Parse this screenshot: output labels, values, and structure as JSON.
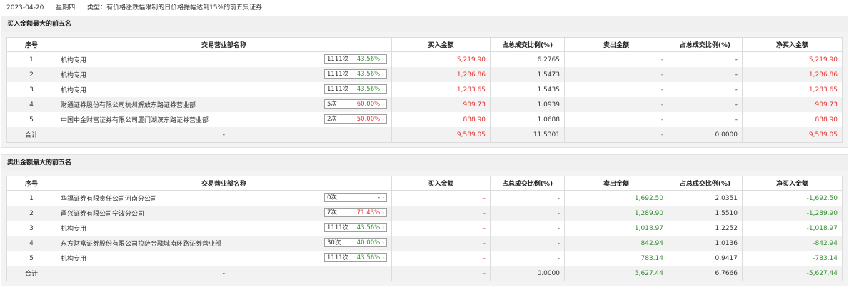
{
  "header": {
    "date": "2023-04-20",
    "weekday": "星期四",
    "type_text": "类型：有价格涨跌幅限制的日价格振幅达到15%的前五只证券"
  },
  "columns": [
    "序号",
    "交易营业部名称",
    "买入金额",
    "占总成交比例(%)",
    "卖出金额",
    "占总成交比例(%)",
    "净买入金额"
  ],
  "buy_section": {
    "title": "买入金额最大的前五名",
    "rows": [
      {
        "no": "1",
        "name": "机构专用",
        "count": "1111次",
        "pct": "43.56%",
        "pct_color": "green",
        "buy": "5,219.90",
        "buy_ratio": "6.2765",
        "sell": "-",
        "sell_ratio": "-",
        "net": "5,219.90"
      },
      {
        "no": "2",
        "name": "机构专用",
        "count": "1111次",
        "pct": "43.56%",
        "pct_color": "green",
        "buy": "1,286.86",
        "buy_ratio": "1.5473",
        "sell": "-",
        "sell_ratio": "-",
        "net": "1,286.86"
      },
      {
        "no": "3",
        "name": "机构专用",
        "count": "1111次",
        "pct": "43.56%",
        "pct_color": "green",
        "buy": "1,283.65",
        "buy_ratio": "1.5435",
        "sell": "-",
        "sell_ratio": "-",
        "net": "1,283.65"
      },
      {
        "no": "4",
        "name": "财通证券股份有限公司杭州解放东路证券营业部",
        "count": "5次",
        "pct": "60.00%",
        "pct_color": "red",
        "buy": "909.73",
        "buy_ratio": "1.0939",
        "sell": "-",
        "sell_ratio": "-",
        "net": "909.73"
      },
      {
        "no": "5",
        "name": "中国中金财富证券有限公司厦门湖滨东路证券营业部",
        "count": "2次",
        "pct": "50.00%",
        "pct_color": "red",
        "buy": "888.90",
        "buy_ratio": "1.0688",
        "sell": "-",
        "sell_ratio": "-",
        "net": "888.90"
      }
    ],
    "total": {
      "label": "合计",
      "name": "-",
      "buy": "9,589.05",
      "buy_ratio": "11.5301",
      "sell": "-",
      "sell_ratio": "0.0000",
      "net": "9,589.05"
    }
  },
  "sell_section": {
    "title": "卖出金额最大的前五名",
    "rows": [
      {
        "no": "1",
        "name": "华福证券有限责任公司河南分公司",
        "count": "0次",
        "pct": "-",
        "pct_color": "dark",
        "buy": "-",
        "buy_ratio": "-",
        "sell": "1,692.50",
        "sell_ratio": "2.0351",
        "net": "-1,692.50"
      },
      {
        "no": "2",
        "name": "甬兴证券有限公司宁波分公司",
        "count": "7次",
        "pct": "71.43%",
        "pct_color": "red",
        "buy": "-",
        "buy_ratio": "-",
        "sell": "1,289.90",
        "sell_ratio": "1.5510",
        "net": "-1,289.90"
      },
      {
        "no": "3",
        "name": "机构专用",
        "count": "1111次",
        "pct": "43.56%",
        "pct_color": "green",
        "buy": "-",
        "buy_ratio": "-",
        "sell": "1,018.97",
        "sell_ratio": "1.2252",
        "net": "-1,018.97"
      },
      {
        "no": "4",
        "name": "东方财富证券股份有限公司拉萨金融城南环路证券营业部",
        "count": "30次",
        "pct": "40.00%",
        "pct_color": "green",
        "buy": "-",
        "buy_ratio": "-",
        "sell": "842.94",
        "sell_ratio": "1.0136",
        "net": "-842.94"
      },
      {
        "no": "5",
        "name": "机构专用",
        "count": "1111次",
        "pct": "43.56%",
        "pct_color": "green",
        "buy": "-",
        "buy_ratio": "-",
        "sell": "783.14",
        "sell_ratio": "0.9417",
        "net": "-783.14"
      }
    ],
    "total": {
      "label": "合计",
      "name": "-",
      "buy": "-",
      "buy_ratio": "0.0000",
      "sell": "5,627.44",
      "sell_ratio": "6.7666",
      "net": "-5,627.44"
    }
  },
  "colors": {
    "positive": "#e3302f",
    "negative": "#2f8f2f",
    "neutral": "#333333"
  },
  "icons": {
    "count_arrow": "chevron-right-icon"
  }
}
